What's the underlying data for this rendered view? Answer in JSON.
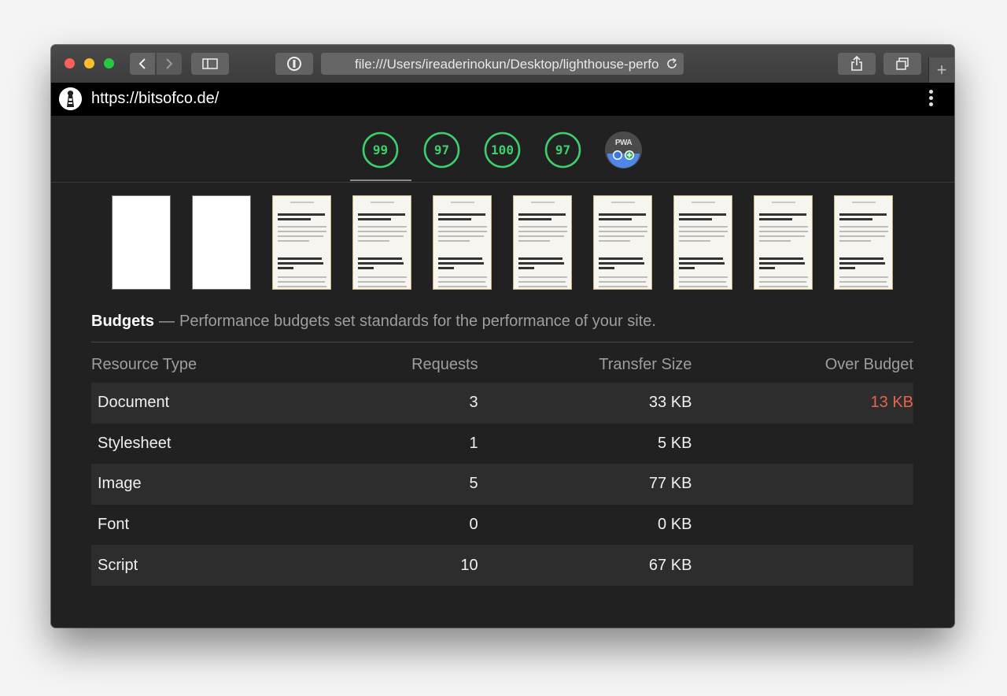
{
  "browser": {
    "address": "file:///Users/ireaderinokun/Desktop/lighthouse-perfo"
  },
  "report": {
    "url": "https://bitsofco.de/"
  },
  "gauges": [
    {
      "value": "99",
      "color": "#3ecf6c"
    },
    {
      "value": "97",
      "color": "#3ecf6c"
    },
    {
      "value": "100",
      "color": "#3ecf6c"
    },
    {
      "value": "97",
      "color": "#3ecf6c"
    }
  ],
  "pwa_badge": {
    "label": "PWA"
  },
  "filmstrip": {
    "frames": [
      "blank",
      "blank",
      "loaded",
      "loaded",
      "loaded",
      "loaded",
      "loaded",
      "loaded",
      "loaded",
      "loaded"
    ]
  },
  "budgets": {
    "title": "Budgets",
    "dash": "—",
    "description": "Performance budgets set standards for the performance of your site.",
    "headers": [
      "Resource Type",
      "Requests",
      "Transfer Size",
      "Over Budget"
    ],
    "rows": [
      {
        "type": "Document",
        "requests": "3",
        "size": "33 KB",
        "over": "13 KB"
      },
      {
        "type": "Stylesheet",
        "requests": "1",
        "size": "5 KB",
        "over": ""
      },
      {
        "type": "Image",
        "requests": "5",
        "size": "77 KB",
        "over": ""
      },
      {
        "type": "Font",
        "requests": "0",
        "size": "0 KB",
        "over": ""
      },
      {
        "type": "Script",
        "requests": "10",
        "size": "67 KB",
        "over": ""
      }
    ],
    "over_color": "#e8644f"
  }
}
